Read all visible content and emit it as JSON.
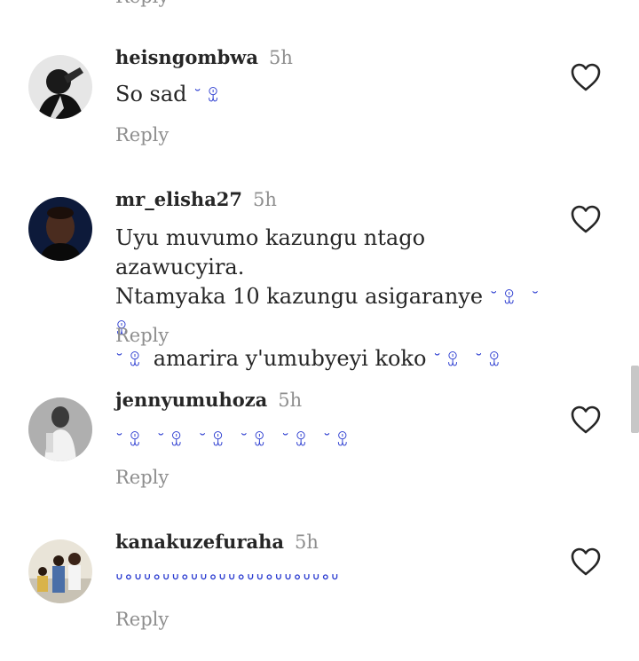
{
  "top_reply_label": "Reply",
  "comments": [
    {
      "username": "heisngombwa",
      "time": "5h",
      "text_line1": "So sad ",
      "emoji": "˘ꀾ",
      "reply_label": "Reply"
    },
    {
      "username": "mr_elisha27",
      "time": "5h",
      "text_line1": "Uyu muvumo kazungu ntago azawucyira.",
      "text_line2": "Ntamyaka 10 kazungu asigaranye ",
      "emoji_line2": "˘ꀾ ˘ꀾ",
      "emoji_line3a": "˘ꀾ",
      "text_line3": " amarira y'umubyeyi koko ",
      "emoji_line3b": "˘ꀾ ˘ꀾ",
      "reply_label": "Reply"
    },
    {
      "username": "jennyumuhoza",
      "time": "5h",
      "emoji": "˘ꀾ ˘ꀾ ˘ꀾ ˘ꀾ ˘ꀾ ˘ꀾ",
      "reply_label": "Reply"
    },
    {
      "username": "kanakuzefuraha",
      "time": "5h",
      "emoji": "ᐡᐤᐡᐡᐤᐡᐡᐤᐡᐡᐤᐡᐡᐤᐡᐡᐤᐡᐡᐤᐡᐡᐤᐡ",
      "reply_label": "Reply"
    }
  ],
  "colors": {
    "text": "#262626",
    "secondary": "#8e8e8e",
    "emoji": "#2a3bd0",
    "scrollbar": "#c7c7c7"
  },
  "icons": {
    "like": "heart-outline-icon"
  }
}
